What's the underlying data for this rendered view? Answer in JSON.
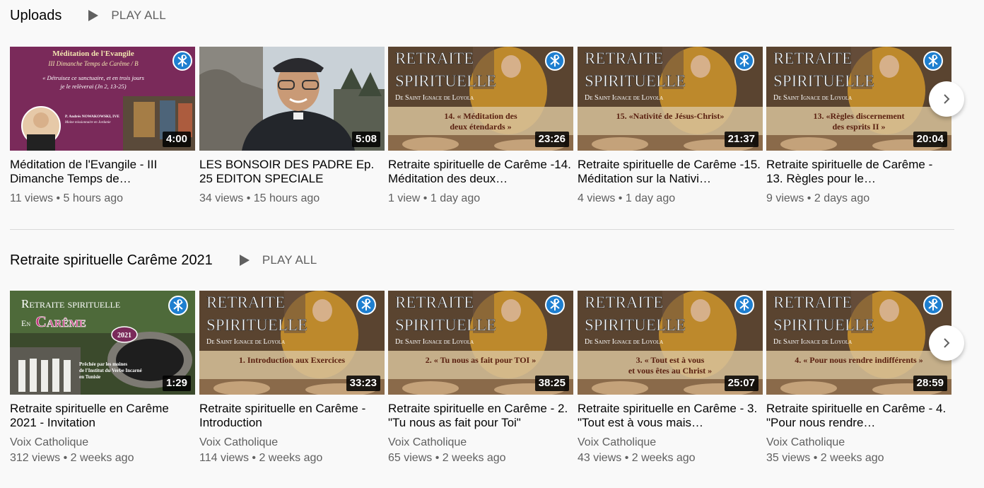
{
  "shelves": [
    {
      "title": "Uploads",
      "play_all_label": "PLAY ALL",
      "videos": [
        {
          "thumb": {
            "style": "meditation",
            "line1": "Méditation de l'Evangile",
            "line2": "III Dimanche Temps de Carême / B",
            "quote1": "« Détruisez ce sanctuaire, et en trois jours",
            "quote2": "je le relèverai (Jn 2, 13-25)",
            "author1": "P. Andrés NOWAKOWSKI, IVE",
            "author2": "Moine missionnaire en Jordanie"
          },
          "duration": "4:00",
          "title": "Méditation de l'Evangile - III Dimanche Temps de…",
          "meta": "11 views • 5 hours ago"
        },
        {
          "thumb": {
            "style": "photo"
          },
          "duration": "5:08",
          "title": "LES BONSOIR DES PADRE Ep. 25 EDITON SPECIALE",
          "meta": "34 views • 15 hours ago"
        },
        {
          "thumb": {
            "style": "retraite",
            "header1": "Retraite",
            "header2": "spirituelle",
            "subtitle": "De Saint Ignace de Loyola",
            "caption1": "14. « Méditation des",
            "caption2": "deux étendards »"
          },
          "duration": "23:26",
          "title": "Retraite spirituelle de Carême -14. Méditation des deux…",
          "meta": "1 view • 1 day ago"
        },
        {
          "thumb": {
            "style": "retraite",
            "header1": "Retraite",
            "header2": "spirituelle",
            "subtitle": "De Saint Ignace de Loyola",
            "caption1": "15. «Nativité de Jésus-Christ»",
            "caption2": ""
          },
          "duration": "21:37",
          "title": "Retraite spirituelle de Carême -15. Méditation sur la Nativi…",
          "meta": "4 views • 1 day ago"
        },
        {
          "thumb": {
            "style": "retraite",
            "header1": "Retraite",
            "header2": "spirituelle",
            "subtitle": "De Saint Ignace de Loyola",
            "caption1": "13. «Règles discernement",
            "caption2": "des esprits II »"
          },
          "duration": "20:04",
          "title": "Retraite spirituelle de Carême - 13. Règles pour le…",
          "meta": "9 views • 2 days ago"
        }
      ]
    },
    {
      "title": "Retraite spirituelle Carême 2021",
      "play_all_label": "PLAY ALL",
      "videos": [
        {
          "thumb": {
            "style": "invitation",
            "line1": "Retraite spirituelle",
            "line2a": "En",
            "line2b": "Carême",
            "year": "2021",
            "small1": "Prêchée par les moines",
            "small2": "de l'Institut du Verbe Incarné",
            "small3": "en Tunisie"
          },
          "duration": "1:29",
          "title": "Retraite spirituelle en Carême 2021 - Invitation",
          "channel": "Voix Catholique",
          "meta": "312 views • 2 weeks ago"
        },
        {
          "thumb": {
            "style": "retraite",
            "header1": "Retraite",
            "header2": "spirituelle",
            "subtitle": "De Saint Ignace de Loyola",
            "caption1": "1. Introduction aux Exercices",
            "caption2": ""
          },
          "duration": "33:23",
          "title": "Retraite spirituelle en Carême - Introduction",
          "channel": "Voix Catholique",
          "meta": "114 views • 2 weeks ago"
        },
        {
          "thumb": {
            "style": "retraite",
            "header1": "Retraite",
            "header2": "spirituelle",
            "subtitle": "De Saint Ignace de Loyola",
            "caption1": "2. « Tu nous as fait pour TOI »",
            "caption2": ""
          },
          "duration": "38:25",
          "title": "Retraite spirituelle en Carême - 2. \"Tu nous as fait pour Toi\"",
          "channel": "Voix Catholique",
          "meta": "65 views • 2 weeks ago"
        },
        {
          "thumb": {
            "style": "retraite",
            "header1": "Retraite",
            "header2": "spirituelle",
            "subtitle": "De Saint Ignace de Loyola",
            "caption1": "3. « Tout est à vous",
            "caption2": "et vous êtes au Christ »"
          },
          "duration": "25:07",
          "title": "Retraite spirituelle en Carême - 3. \"Tout est à vous mais…",
          "channel": "Voix Catholique",
          "meta": "43 views • 2 weeks ago"
        },
        {
          "thumb": {
            "style": "retraite",
            "header1": "Retraite",
            "header2": "spirituelle",
            "subtitle": "De Saint Ignace de Loyola",
            "caption1": "4. « Pour nous rendre indifférents »",
            "caption2": ""
          },
          "duration": "28:59",
          "title": "Retraite spirituelle en Carême - 4. \"Pour nous rendre…",
          "channel": "Voix Catholique",
          "meta": "35 views • 2 weeks ago"
        }
      ]
    }
  ],
  "icons": {
    "play_all": "play-triangle-icon",
    "next": "chevron-right-icon",
    "logo": "chi-rho-logo-icon"
  },
  "colors": {
    "text": "#030303",
    "secondary": "#606060",
    "meditation_bg": "#7a2a5a",
    "retraite_band": "#d8c29a"
  }
}
